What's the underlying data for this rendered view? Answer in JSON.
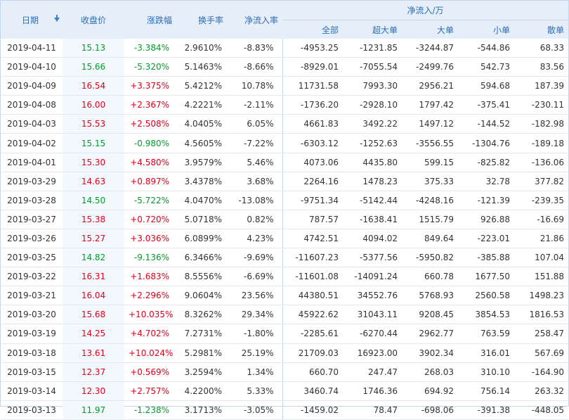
{
  "header": {
    "date": "日期",
    "price": "收盘价",
    "change": "涨跌幅",
    "turnover": "换手率",
    "net_pct": "净流入率",
    "flow_title": "净流入/万",
    "all": "全部",
    "xlarge": "超大单",
    "large": "大单",
    "small": "小单",
    "retail": "散单"
  },
  "colors": {
    "up": "#e0001b",
    "down": "#059a2c",
    "header_bg": "#e6eff9",
    "header_text": "#2a6cb8"
  },
  "rows": [
    {
      "date": "2019-04-11",
      "price": "15.13",
      "change": "-3.384%",
      "turnover": "2.9610%",
      "net_pct": "-8.83%",
      "all": "-4953.25",
      "xlarge": "-1231.85",
      "large": "-3244.87",
      "small": "-544.86",
      "retail": "68.33",
      "dir": "down"
    },
    {
      "date": "2019-04-10",
      "price": "15.66",
      "change": "-5.320%",
      "turnover": "5.1463%",
      "net_pct": "-8.66%",
      "all": "-8929.01",
      "xlarge": "-7055.54",
      "large": "-2499.76",
      "small": "542.73",
      "retail": "83.56",
      "dir": "down"
    },
    {
      "date": "2019-04-09",
      "price": "16.54",
      "change": "+3.375%",
      "turnover": "5.4212%",
      "net_pct": "10.78%",
      "all": "11731.58",
      "xlarge": "7993.30",
      "large": "2956.21",
      "small": "594.68",
      "retail": "187.39",
      "dir": "up"
    },
    {
      "date": "2019-04-08",
      "price": "16.00",
      "change": "+2.367%",
      "turnover": "4.2221%",
      "net_pct": "-2.11%",
      "all": "-1736.20",
      "xlarge": "-2928.10",
      "large": "1797.42",
      "small": "-375.41",
      "retail": "-230.11",
      "dir": "up"
    },
    {
      "date": "2019-04-03",
      "price": "15.53",
      "change": "+2.508%",
      "turnover": "4.0405%",
      "net_pct": "6.05%",
      "all": "4661.83",
      "xlarge": "3492.22",
      "large": "1497.12",
      "small": "-144.52",
      "retail": "-182.98",
      "dir": "up"
    },
    {
      "date": "2019-04-02",
      "price": "15.15",
      "change": "-0.980%",
      "turnover": "4.5605%",
      "net_pct": "-7.22%",
      "all": "-6303.12",
      "xlarge": "-1252.63",
      "large": "-3556.55",
      "small": "-1304.76",
      "retail": "-189.18",
      "dir": "down"
    },
    {
      "date": "2019-04-01",
      "price": "15.30",
      "change": "+4.580%",
      "turnover": "3.9579%",
      "net_pct": "5.46%",
      "all": "4073.06",
      "xlarge": "4435.80",
      "large": "599.15",
      "small": "-825.82",
      "retail": "-136.06",
      "dir": "up"
    },
    {
      "date": "2019-03-29",
      "price": "14.63",
      "change": "+0.897%",
      "turnover": "3.4378%",
      "net_pct": "3.68%",
      "all": "2264.16",
      "xlarge": "1478.23",
      "large": "375.33",
      "small": "32.78",
      "retail": "377.82",
      "dir": "up"
    },
    {
      "date": "2019-03-28",
      "price": "14.50",
      "change": "-5.722%",
      "turnover": "4.0470%",
      "net_pct": "-13.08%",
      "all": "-9751.34",
      "xlarge": "-5142.44",
      "large": "-4248.16",
      "small": "-121.39",
      "retail": "-239.35",
      "dir": "down"
    },
    {
      "date": "2019-03-27",
      "price": "15.38",
      "change": "+0.720%",
      "turnover": "5.0718%",
      "net_pct": "0.82%",
      "all": "787.57",
      "xlarge": "-1638.41",
      "large": "1515.79",
      "small": "926.88",
      "retail": "-16.69",
      "dir": "up"
    },
    {
      "date": "2019-03-26",
      "price": "15.27",
      "change": "+3.036%",
      "turnover": "6.0899%",
      "net_pct": "4.23%",
      "all": "4742.51",
      "xlarge": "4094.02",
      "large": "849.64",
      "small": "-223.01",
      "retail": "21.86",
      "dir": "up"
    },
    {
      "date": "2019-03-25",
      "price": "14.82",
      "change": "-9.136%",
      "turnover": "6.3466%",
      "net_pct": "-9.69%",
      "all": "-11607.23",
      "xlarge": "-5377.56",
      "large": "-5950.82",
      "small": "-385.88",
      "retail": "107.04",
      "dir": "down"
    },
    {
      "date": "2019-03-22",
      "price": "16.31",
      "change": "+1.683%",
      "turnover": "8.5556%",
      "net_pct": "-6.69%",
      "all": "-11601.08",
      "xlarge": "-14091.24",
      "large": "660.78",
      "small": "1677.50",
      "retail": "151.88",
      "dir": "up"
    },
    {
      "date": "2019-03-21",
      "price": "16.04",
      "change": "+2.296%",
      "turnover": "9.0604%",
      "net_pct": "23.56%",
      "all": "44380.51",
      "xlarge": "34552.76",
      "large": "5768.93",
      "small": "2560.58",
      "retail": "1498.23",
      "dir": "up"
    },
    {
      "date": "2019-03-20",
      "price": "15.68",
      "change": "+10.035%",
      "turnover": "8.3262%",
      "net_pct": "29.34%",
      "all": "45922.62",
      "xlarge": "31043.11",
      "large": "9208.45",
      "small": "3854.53",
      "retail": "1816.53",
      "dir": "up"
    },
    {
      "date": "2019-03-19",
      "price": "14.25",
      "change": "+4.702%",
      "turnover": "7.2731%",
      "net_pct": "-1.80%",
      "all": "-2285.61",
      "xlarge": "-6270.44",
      "large": "2962.77",
      "small": "763.59",
      "retail": "258.47",
      "dir": "up"
    },
    {
      "date": "2019-03-18",
      "price": "13.61",
      "change": "+10.024%",
      "turnover": "5.2981%",
      "net_pct": "25.19%",
      "all": "21709.03",
      "xlarge": "16923.00",
      "large": "3902.34",
      "small": "316.01",
      "retail": "567.69",
      "dir": "up"
    },
    {
      "date": "2019-03-15",
      "price": "12.37",
      "change": "+0.569%",
      "turnover": "3.2594%",
      "net_pct": "1.34%",
      "all": "660.70",
      "xlarge": "247.47",
      "large": "268.03",
      "small": "310.10",
      "retail": "-164.90",
      "dir": "up"
    },
    {
      "date": "2019-03-14",
      "price": "12.30",
      "change": "+2.757%",
      "turnover": "4.2200%",
      "net_pct": "5.33%",
      "all": "3460.74",
      "xlarge": "1746.36",
      "large": "694.92",
      "small": "756.14",
      "retail": "263.32",
      "dir": "up"
    },
    {
      "date": "2019-03-13",
      "price": "11.97",
      "change": "-1.238%",
      "turnover": "3.1713%",
      "net_pct": "-3.05%",
      "all": "-1459.02",
      "xlarge": "78.47",
      "large": "-698.06",
      "small": "-391.38",
      "retail": "-448.05",
      "dir": "down"
    }
  ]
}
